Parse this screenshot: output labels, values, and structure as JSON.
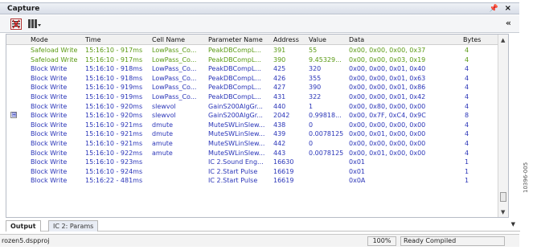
{
  "window": {
    "title": "Capture",
    "pin_icon": "pin-icon",
    "close_label": "×"
  },
  "toolbar": {
    "collapse_label": "«"
  },
  "columns": [
    "Mode",
    "Time",
    "Cell Name",
    "Parameter Name",
    "Address",
    "Value",
    "Data",
    "Bytes"
  ],
  "rows": [
    {
      "mode": "Safeload Write",
      "time": "15:16:10 - 917ms",
      "cell": "LowPass_Co...",
      "param": "PeakDBCompL...",
      "address": "391",
      "value": "55",
      "data": "0x00, 0x00, 0x00, 0x37",
      "bytes": "4",
      "color": "green"
    },
    {
      "mode": "Safeload Write",
      "time": "15:16:10 - 917ms",
      "cell": "LowPass_Co...",
      "param": "PeakDBCompL...",
      "address": "390",
      "value": "9.45329...",
      "data": "0x00, 0x00, 0x03, 0x19",
      "bytes": "4",
      "color": "green"
    },
    {
      "mode": "Block Write",
      "time": "15:16:10 - 918ms",
      "cell": "LowPass_Co...",
      "param": "PeakDBCompL...",
      "address": "425",
      "value": "320",
      "data": "0x00, 0x00, 0x01, 0x40",
      "bytes": "4",
      "color": "blue"
    },
    {
      "mode": "Block Write",
      "time": "15:16:10 - 918ms",
      "cell": "LowPass_Co...",
      "param": "PeakDBCompL...",
      "address": "426",
      "value": "355",
      "data": "0x00, 0x00, 0x01, 0x63",
      "bytes": "4",
      "color": "blue"
    },
    {
      "mode": "Block Write",
      "time": "15:16:10 - 919ms",
      "cell": "LowPass_Co...",
      "param": "PeakDBCompL...",
      "address": "427",
      "value": "390",
      "data": "0x00, 0x00, 0x01, 0x86",
      "bytes": "4",
      "color": "blue"
    },
    {
      "mode": "Block Write",
      "time": "15:16:10 - 919ms",
      "cell": "LowPass_Co...",
      "param": "PeakDBCompL...",
      "address": "431",
      "value": "322",
      "data": "0x00, 0x00, 0x01, 0x42",
      "bytes": "4",
      "color": "blue"
    },
    {
      "mode": "Block Write",
      "time": "15:16:10 - 920ms",
      "cell": "slewvol",
      "param": "GainS200AlgGr...",
      "address": "440",
      "value": "1",
      "data": "0x00, 0x80, 0x00, 0x00",
      "bytes": "4",
      "color": "blue"
    },
    {
      "mode": "Block Write",
      "time": "15:16:10 - 920ms",
      "cell": "slewvol",
      "param": "GainS200AlgGr...",
      "address": "2042",
      "value": "0.99818...",
      "data": "0x00, 0x7F, 0xC4, 0x9C",
      "bytes": "8",
      "color": "blue",
      "expander": "⊞"
    },
    {
      "mode": "Block Write",
      "time": "15:16:10 - 921ms",
      "cell": "dmute",
      "param": "MuteSWLinSlew...",
      "address": "438",
      "value": "0",
      "data": "0x00, 0x00, 0x00, 0x00",
      "bytes": "4",
      "color": "blue"
    },
    {
      "mode": "Block Write",
      "time": "15:16:10 - 921ms",
      "cell": "dmute",
      "param": "MuteSWLinSlew...",
      "address": "439",
      "value": "0.0078125",
      "data": "0x00, 0x01, 0x00, 0x00",
      "bytes": "4",
      "color": "blue"
    },
    {
      "mode": "Block Write",
      "time": "15:16:10 - 921ms",
      "cell": "amute",
      "param": "MuteSWLinSlew...",
      "address": "442",
      "value": "0",
      "data": "0x00, 0x00, 0x00, 0x00",
      "bytes": "4",
      "color": "blue"
    },
    {
      "mode": "Block Write",
      "time": "15:16:10 - 922ms",
      "cell": "amute",
      "param": "MuteSWLinSlew...",
      "address": "443",
      "value": "0.0078125",
      "data": "0x00, 0x01, 0x00, 0x00",
      "bytes": "4",
      "color": "blue"
    },
    {
      "mode": "Block Write",
      "time": "15:16:10 - 923ms",
      "cell": "",
      "param": "IC 2.Sound Eng...",
      "address": "16630",
      "value": "",
      "data": "0x01",
      "bytes": "1",
      "color": "blue"
    },
    {
      "mode": "Block Write",
      "time": "15:16:10 - 924ms",
      "cell": "",
      "param": "IC 2.Start Pulse",
      "address": "16619",
      "value": "",
      "data": "0x01",
      "bytes": "1",
      "color": "blue"
    },
    {
      "mode": "Block Write",
      "time": "15:16:22 - 481ms",
      "cell": "",
      "param": "IC 2.Start Pulse",
      "address": "16619",
      "value": "",
      "data": "0x0A",
      "bytes": "1",
      "color": "blue"
    }
  ],
  "tabs": [
    {
      "label": "Output",
      "active": true
    },
    {
      "label": "IC 2: Params",
      "active": false
    }
  ],
  "status": {
    "file": "rozen5.dspproj",
    "zoom": "100%",
    "message": "Ready  Compiled"
  },
  "sidecode": "10396-005",
  "colors": {
    "green_text": "#5a9a14",
    "blue_text": "#2a35b8"
  }
}
